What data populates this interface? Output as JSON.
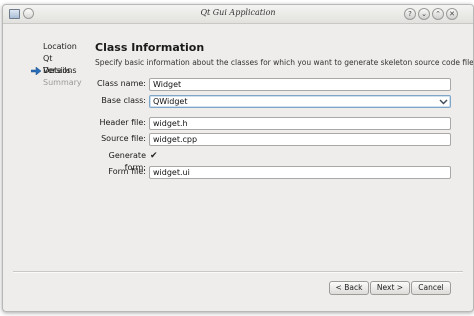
{
  "window": {
    "title": "Qt Gui Application"
  },
  "titlebar_buttons": [
    "?",
    "⌄",
    "⌃",
    "✕"
  ],
  "sidebar": {
    "items": [
      {
        "label": "Location",
        "state": "done"
      },
      {
        "label": "Qt Versions",
        "state": "done"
      },
      {
        "label": "Details",
        "state": "current"
      },
      {
        "label": "Summary",
        "state": "disabled"
      }
    ]
  },
  "page": {
    "title": "Class Information",
    "subtitle": "Specify basic information about the classes for which you want to generate skeleton source code files."
  },
  "form": {
    "class_name": {
      "label": "Class name:",
      "value": "Widget"
    },
    "base_class": {
      "label": "Base class:",
      "value": "QWidget"
    },
    "header_file": {
      "label": "Header file:",
      "value": "widget.h"
    },
    "source_file": {
      "label": "Source file:",
      "value": "widget.cpp"
    },
    "generate_form": {
      "label": "Generate form:",
      "checked": true,
      "mark": "✔"
    },
    "form_file": {
      "label": "Form file:",
      "value": "widget.ui"
    }
  },
  "buttons": {
    "back": "< Back",
    "next": "Next >",
    "cancel": "Cancel"
  },
  "colors": {
    "accent": "#2a6ebb",
    "window_bg": "#eeedeb"
  }
}
